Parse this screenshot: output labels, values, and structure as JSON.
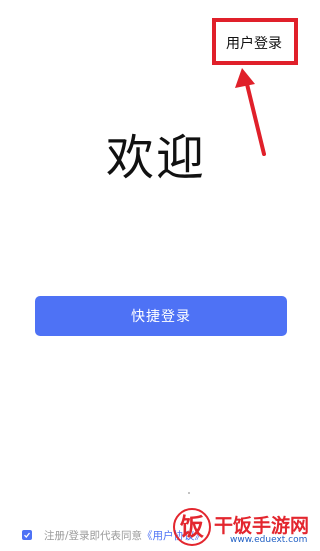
{
  "header": {
    "user_login_label": "用户登录"
  },
  "main": {
    "welcome_title": "欢迎",
    "quick_login_label": "快捷登录"
  },
  "footer": {
    "agreement_text": "注册/登录即代表同意",
    "agreement_link_text": "《用户协议》",
    "checkbox_checked": true
  },
  "annotation": {
    "highlight_color": "#e0202a"
  },
  "watermark": {
    "title": "干饭手游网",
    "url": "www.eduext.com",
    "logo_char": "饭"
  },
  "colors": {
    "accent": "#4e72f5",
    "text": "#111111",
    "muted": "#9a9a9a",
    "watermark_red": "#e3262e"
  }
}
